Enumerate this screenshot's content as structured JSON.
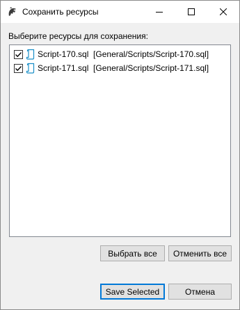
{
  "window": {
    "title": "Сохранить ресурсы",
    "app_icon": "dbeaver-beaver-icon",
    "controls": [
      "minimize-icon",
      "maximize-icon",
      "close-icon"
    ]
  },
  "prompt": "Выберите ресурсы для сохранения:",
  "resources": [
    {
      "name": "Script-170.sql",
      "path": "[General/Scripts/Script-170.sql]",
      "checked": true,
      "icon": "sql-script-file-icon"
    },
    {
      "name": "Script-171.sql",
      "path": "[General/Scripts/Script-171.sql]",
      "checked": true,
      "icon": "sql-script-file-icon"
    }
  ],
  "buttons": {
    "select_all": "Выбрать все",
    "deselect_all": "Отменить все",
    "save_selected": "Save Selected",
    "cancel": "Отмена"
  },
  "colors": {
    "accent": "#0078d7",
    "file_icon": "#1a8fc8"
  }
}
